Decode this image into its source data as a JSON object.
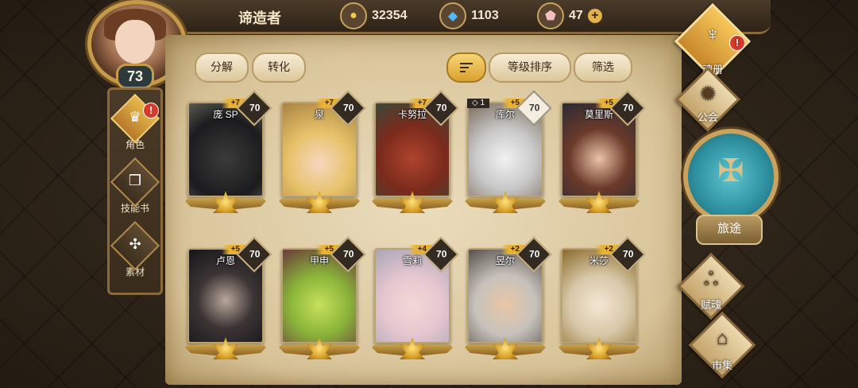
{
  "player": {
    "name": "谛造者",
    "level": "73"
  },
  "resources": [
    {
      "icon": "gold-coin-icon",
      "value": "32354"
    },
    {
      "icon": "blue-crystal-icon",
      "value": "1103"
    },
    {
      "icon": "pink-gem-icon",
      "value": "47"
    }
  ],
  "left_menu": [
    {
      "label": "角色",
      "icon": "character-icon",
      "active": true,
      "badge": "!"
    },
    {
      "label": "技能书",
      "icon": "skill-book-icon",
      "active": false
    },
    {
      "label": "素材",
      "icon": "material-icon",
      "active": false
    }
  ],
  "toolbar": {
    "decompose": "分解",
    "transform": "转化",
    "sort_by_level": "等级排序",
    "filter": "筛选"
  },
  "cards": [
    {
      "name": "庞 SP",
      "plus": "+7",
      "level": "70",
      "theme": "panther"
    },
    {
      "name": "泉",
      "plus": "+7",
      "level": "70",
      "theme": "fox-girl"
    },
    {
      "name": "卡努拉",
      "plus": "+7",
      "level": "70",
      "theme": "dragon"
    },
    {
      "name": "库尔",
      "plus": "+5",
      "level": "70",
      "rank": "1",
      "theme": "wolf",
      "light": true
    },
    {
      "name": "莫里斯",
      "plus": "+5",
      "level": "70",
      "theme": "boy"
    },
    {
      "name": "卢恩",
      "plus": "+5",
      "level": "70",
      "theme": "dark-man"
    },
    {
      "name": "甲申",
      "plus": "+5",
      "level": "70",
      "theme": "lizard"
    },
    {
      "name": "雪莉",
      "plus": "+4",
      "level": "70",
      "theme": "white-girl"
    },
    {
      "name": "昱尔",
      "plus": "+2",
      "level": "70",
      "theme": "white-hair-man"
    },
    {
      "name": "米莎",
      "plus": "+2",
      "level": "70",
      "theme": "girl-crown"
    }
  ],
  "right_nav": [
    {
      "label": "魂册",
      "icon": "soul-book-icon",
      "badge": "!"
    },
    {
      "label": "公会",
      "icon": "guild-icon"
    },
    {
      "label": "旅途",
      "icon": "journey-icon"
    },
    {
      "label": "赋魂",
      "icon": "soul-infuse-icon"
    },
    {
      "label": "市集",
      "icon": "market-icon"
    }
  ],
  "colors": {
    "gold": "#e3b14a",
    "parchment": "#e2d1ac",
    "badge": "#d8392b"
  }
}
